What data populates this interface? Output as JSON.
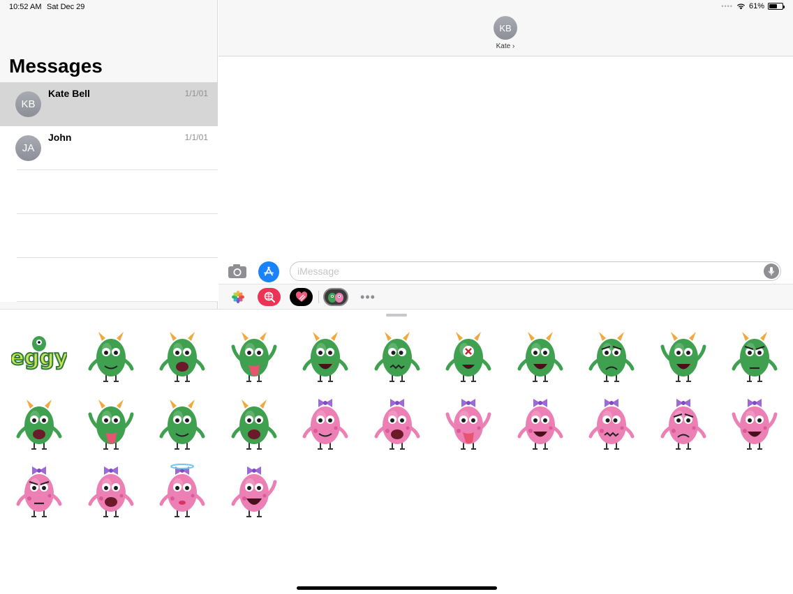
{
  "status_bar": {
    "time": "10:52 AM",
    "date": "Sat Dec 29",
    "battery": "61%",
    "battery_level": 0.61
  },
  "sidebar": {
    "title": "Messages",
    "conversations": [
      {
        "initials": "KB",
        "name": "Kate Bell",
        "date": "1/1/01",
        "selected": true
      },
      {
        "initials": "JA",
        "name": "John",
        "date": "1/1/01",
        "selected": false
      }
    ]
  },
  "conversation": {
    "contact_initials": "KB",
    "contact_name": "Kate",
    "contact_chevron": "›"
  },
  "compose": {
    "placeholder": "iMessage"
  },
  "app_drawer": {
    "more_label": "•••"
  },
  "stickers": {
    "eggy_text": "eggy",
    "items": [
      {
        "kind": "eggy-text",
        "color": "green"
      },
      {
        "kind": "smile",
        "color": "green"
      },
      {
        "kind": "shout",
        "color": "green"
      },
      {
        "kind": "tongue",
        "color": "green"
      },
      {
        "kind": "wink",
        "color": "green"
      },
      {
        "kind": "dizzy",
        "color": "green"
      },
      {
        "kind": "eyepatch",
        "color": "green"
      },
      {
        "kind": "grin",
        "color": "green"
      },
      {
        "kind": "sad",
        "color": "green"
      },
      {
        "kind": "cheer",
        "color": "green"
      },
      {
        "kind": "angry",
        "color": "green"
      },
      {
        "kind": "yell",
        "color": "green"
      },
      {
        "kind": "tongue",
        "color": "green"
      },
      {
        "kind": "smile",
        "color": "green"
      },
      {
        "kind": "shout",
        "color": "green"
      },
      {
        "kind": "smile",
        "color": "pink"
      },
      {
        "kind": "shout",
        "color": "pink"
      },
      {
        "kind": "tongue",
        "color": "pink"
      },
      {
        "kind": "grin",
        "color": "pink"
      },
      {
        "kind": "dizzy",
        "color": "pink"
      },
      {
        "kind": "sad",
        "color": "pink"
      },
      {
        "kind": "cheer",
        "color": "pink"
      },
      {
        "kind": "angry",
        "color": "pink"
      },
      {
        "kind": "shout",
        "color": "pink"
      },
      {
        "kind": "halo",
        "color": "pink"
      },
      {
        "kind": "thumbs",
        "color": "pink"
      }
    ]
  },
  "colors": {
    "accent": "#1a82fb",
    "green_monster": "#3fa04f",
    "pink_monster": "#ec7fb3"
  }
}
